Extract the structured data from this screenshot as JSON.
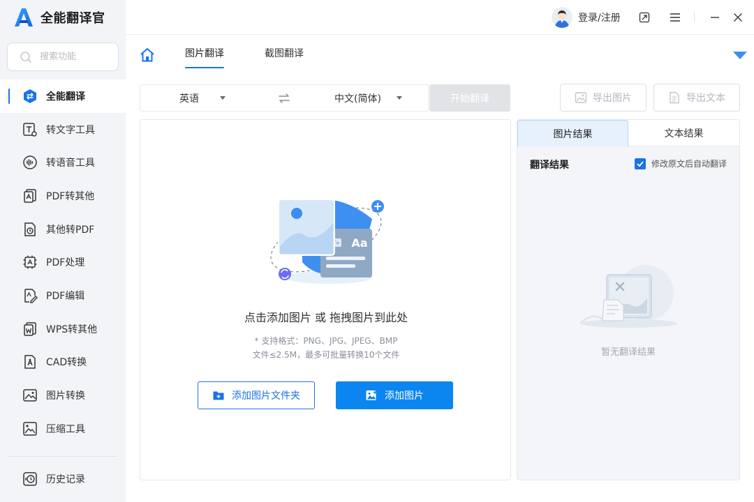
{
  "app": {
    "name": "全能翻译官"
  },
  "search": {
    "placeholder": "搜索功能"
  },
  "sidebar": {
    "items": [
      {
        "label": "全能翻译",
        "icon": "translate-icon",
        "active": true
      },
      {
        "label": "转文字工具",
        "icon": "text-tool-icon"
      },
      {
        "label": "转语音工具",
        "icon": "voice-tool-icon"
      },
      {
        "label": "PDF转其他",
        "icon": "pdf-convert-icon"
      },
      {
        "label": "其他转PDF",
        "icon": "to-pdf-icon"
      },
      {
        "label": "PDF处理",
        "icon": "pdf-process-icon"
      },
      {
        "label": "PDF编辑",
        "icon": "pdf-edit-icon"
      },
      {
        "label": "WPS转其他",
        "icon": "wps-convert-icon"
      },
      {
        "label": "CAD转换",
        "icon": "cad-convert-icon"
      },
      {
        "label": "图片转换",
        "icon": "image-convert-icon"
      },
      {
        "label": "压缩工具",
        "icon": "compress-icon"
      }
    ],
    "history": {
      "label": "历史记录",
      "icon": "history-icon"
    }
  },
  "titlebar": {
    "login_label": "登录/注册"
  },
  "tabs": [
    {
      "label": "图片翻译",
      "active": true
    },
    {
      "label": "截图翻译",
      "active": false
    }
  ],
  "toolbar": {
    "source_lang": "英语",
    "target_lang": "中文(简体)",
    "start_label": "开始翻译",
    "export_image_label": "导出图片",
    "export_text_label": "导出文本"
  },
  "upload": {
    "title": "点击添加图片 或 拖拽图片到此处",
    "formats": "* 支持格式：PNG、JPG、JPEG、BMP",
    "limits": "文件≤2.5M，最多可批量转换10个文件",
    "add_folder_label": "添加图片文件夹",
    "add_image_label": "添加图片"
  },
  "result": {
    "tabs": [
      {
        "label": "图片结果",
        "active": true
      },
      {
        "label": "文本结果",
        "active": false
      }
    ],
    "header": "翻译结果",
    "auto_translate_label": "修改原文后自动翻译",
    "auto_translate_checked": true,
    "empty_text": "暂无翻译结果"
  },
  "colors": {
    "accent": "#1a73e8",
    "primary_button": "#0b85f0",
    "disabled_button": "#e1e3e7",
    "sidebar_bg": "#f2f4f7"
  }
}
